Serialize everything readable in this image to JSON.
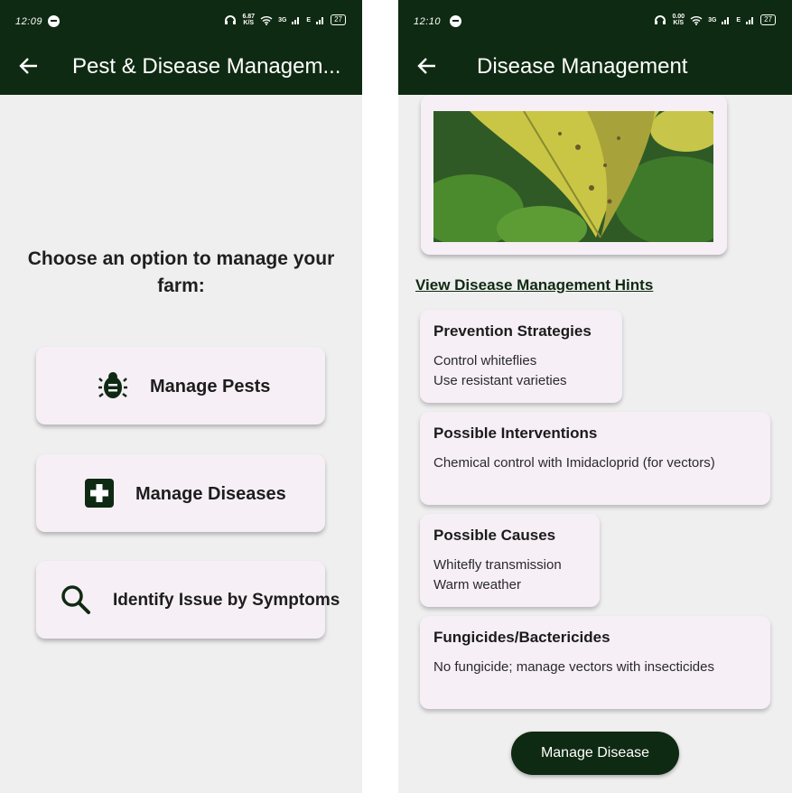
{
  "left_screen": {
    "status": {
      "time": "12:09",
      "speed_top": "6.87",
      "speed_bottom": "K/S",
      "network": "3G",
      "network_e": "E",
      "battery": "27"
    },
    "appbar": {
      "title": "Pest & Disease Managem..."
    },
    "prompt": "Choose an option to manage your farm:",
    "options": [
      {
        "label": "Manage Pests",
        "icon": "bug-icon"
      },
      {
        "label": "Manage Diseases",
        "icon": "medical-cross-icon"
      },
      {
        "label": "Identify Issue by Symptoms",
        "icon": "search-icon"
      }
    ]
  },
  "right_screen": {
    "status": {
      "time": "12:10",
      "speed_top": "0.00",
      "speed_bottom": "K/S",
      "network": "3G",
      "network_e": "E",
      "battery": "27"
    },
    "appbar": {
      "title": "Disease Management"
    },
    "hint_link": "View Disease Management Hints",
    "cards": [
      {
        "title": "Prevention Strategies",
        "lines": [
          "Control whiteflies",
          "Use resistant varieties"
        ]
      },
      {
        "title": "Possible Interventions",
        "lines": [
          "Chemical control with Imidacloprid (for vectors)"
        ]
      },
      {
        "title": "Possible Causes",
        "lines": [
          "Whitefly transmission",
          "Warm weather"
        ]
      },
      {
        "title": "Fungicides/Bactericides",
        "lines": [
          "No fungicide; manage vectors with insecticides"
        ]
      }
    ],
    "button": "Manage Disease"
  },
  "colors": {
    "primary": "#0f2a12",
    "card": "#f6eff6",
    "background": "#efefef"
  }
}
